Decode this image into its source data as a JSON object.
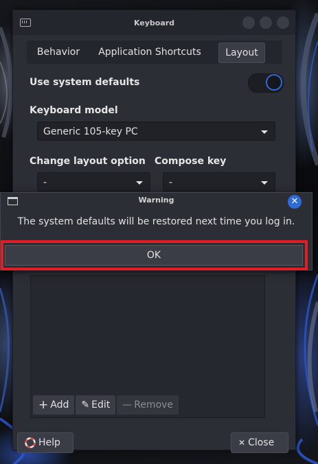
{
  "window": {
    "title": "Keyboard",
    "icon": "keyboard-icon"
  },
  "tabs": [
    {
      "label": "Behavior"
    },
    {
      "label": "Application Shortcuts"
    },
    {
      "label": "Layout",
      "active": true
    }
  ],
  "layout": {
    "use_system_defaults_label": "Use system defaults",
    "use_system_defaults_on": true,
    "keyboard_model_label": "Keyboard model",
    "keyboard_model_value": "Generic 105-key PC",
    "change_layout_label": "Change layout option",
    "change_layout_value": "-",
    "compose_key_label": "Compose key",
    "compose_key_value": "-"
  },
  "list_toolbar": {
    "add_label": "Add",
    "edit_label": "Edit",
    "remove_label": "Remove"
  },
  "footer": {
    "help_label": "Help",
    "close_label": "Close"
  },
  "dialog": {
    "title": "Warning",
    "message": "The system defaults will be restored next time you log in.",
    "ok_label": "OK"
  },
  "colors": {
    "accent": "#2f6bd6",
    "highlight": "#e01e27",
    "window_bg": "#2c2e36"
  }
}
